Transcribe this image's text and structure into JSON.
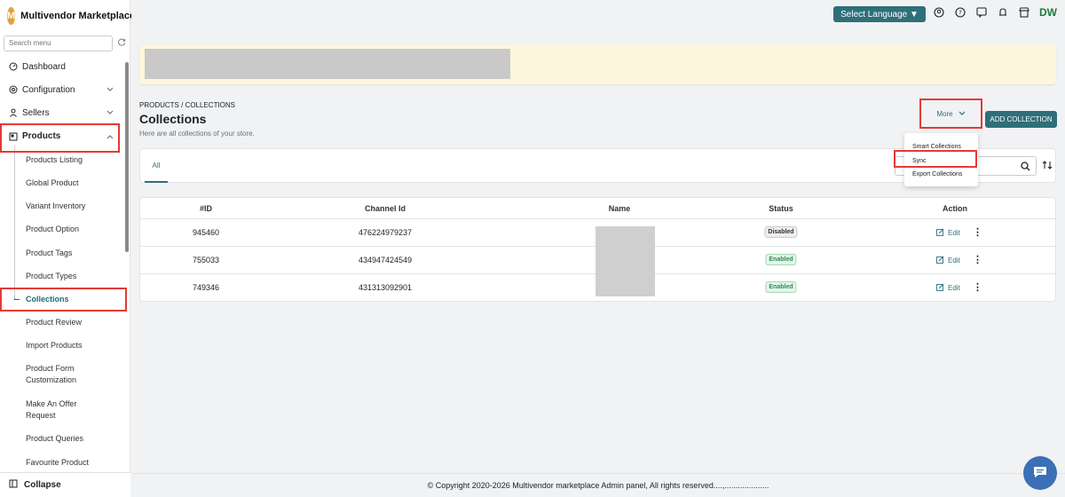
{
  "brand": {
    "initial": "M",
    "name": "Multivendor Marketplace"
  },
  "sidebar": {
    "search_placeholder": "Search menu",
    "items": [
      {
        "label": "Dashboard",
        "icon": "dashboard-icon"
      },
      {
        "label": "Configuration",
        "icon": "gear-icon"
      },
      {
        "label": "Sellers",
        "icon": "user-icon"
      },
      {
        "label": "Products",
        "icon": "products-icon"
      }
    ],
    "products_submenu": [
      "Products Listing",
      "Global Product",
      "Variant Inventory",
      "Product Option",
      "Product Tags",
      "Product Types",
      "Collections",
      "Product Review",
      "Import Products",
      "Product Form Customization",
      "Make An Offer Request",
      "Product Queries",
      "Favourite Product"
    ],
    "collapse_label": "Collapse"
  },
  "topbar": {
    "language_label": "Select Language ▼",
    "user_initials": "DW"
  },
  "header": {
    "breadcrumb": "PRODUCTS / COLLECTIONS",
    "title": "Collections",
    "subtitle": "Here are all collections of your store.",
    "more_label": "More",
    "add_label": "ADD COLLECTION"
  },
  "tabs": {
    "all": "All"
  },
  "dropdown": {
    "items": [
      "Smart Collections",
      "Sync",
      "Export Collections"
    ]
  },
  "table": {
    "columns": [
      "#ID",
      "Channel Id",
      "Name",
      "Status",
      "Action"
    ],
    "rows": [
      {
        "id": "945460",
        "channel_id": "476224979237",
        "status": "Disabled"
      },
      {
        "id": "755033",
        "channel_id": "434947424549",
        "status": "Enabled"
      },
      {
        "id": "749346",
        "channel_id": "431313092901",
        "status": "Enabled"
      }
    ],
    "edit_label": "Edit"
  },
  "footer": {
    "text": "© Copyright 2020-2026 Multivendor marketplace Admin panel, All rights reserved....,...................."
  },
  "colors": {
    "accent": "#2f6f7a",
    "highlight": "#e53935",
    "enabled": "#2e8b57",
    "banner": "#fdf5dc"
  }
}
